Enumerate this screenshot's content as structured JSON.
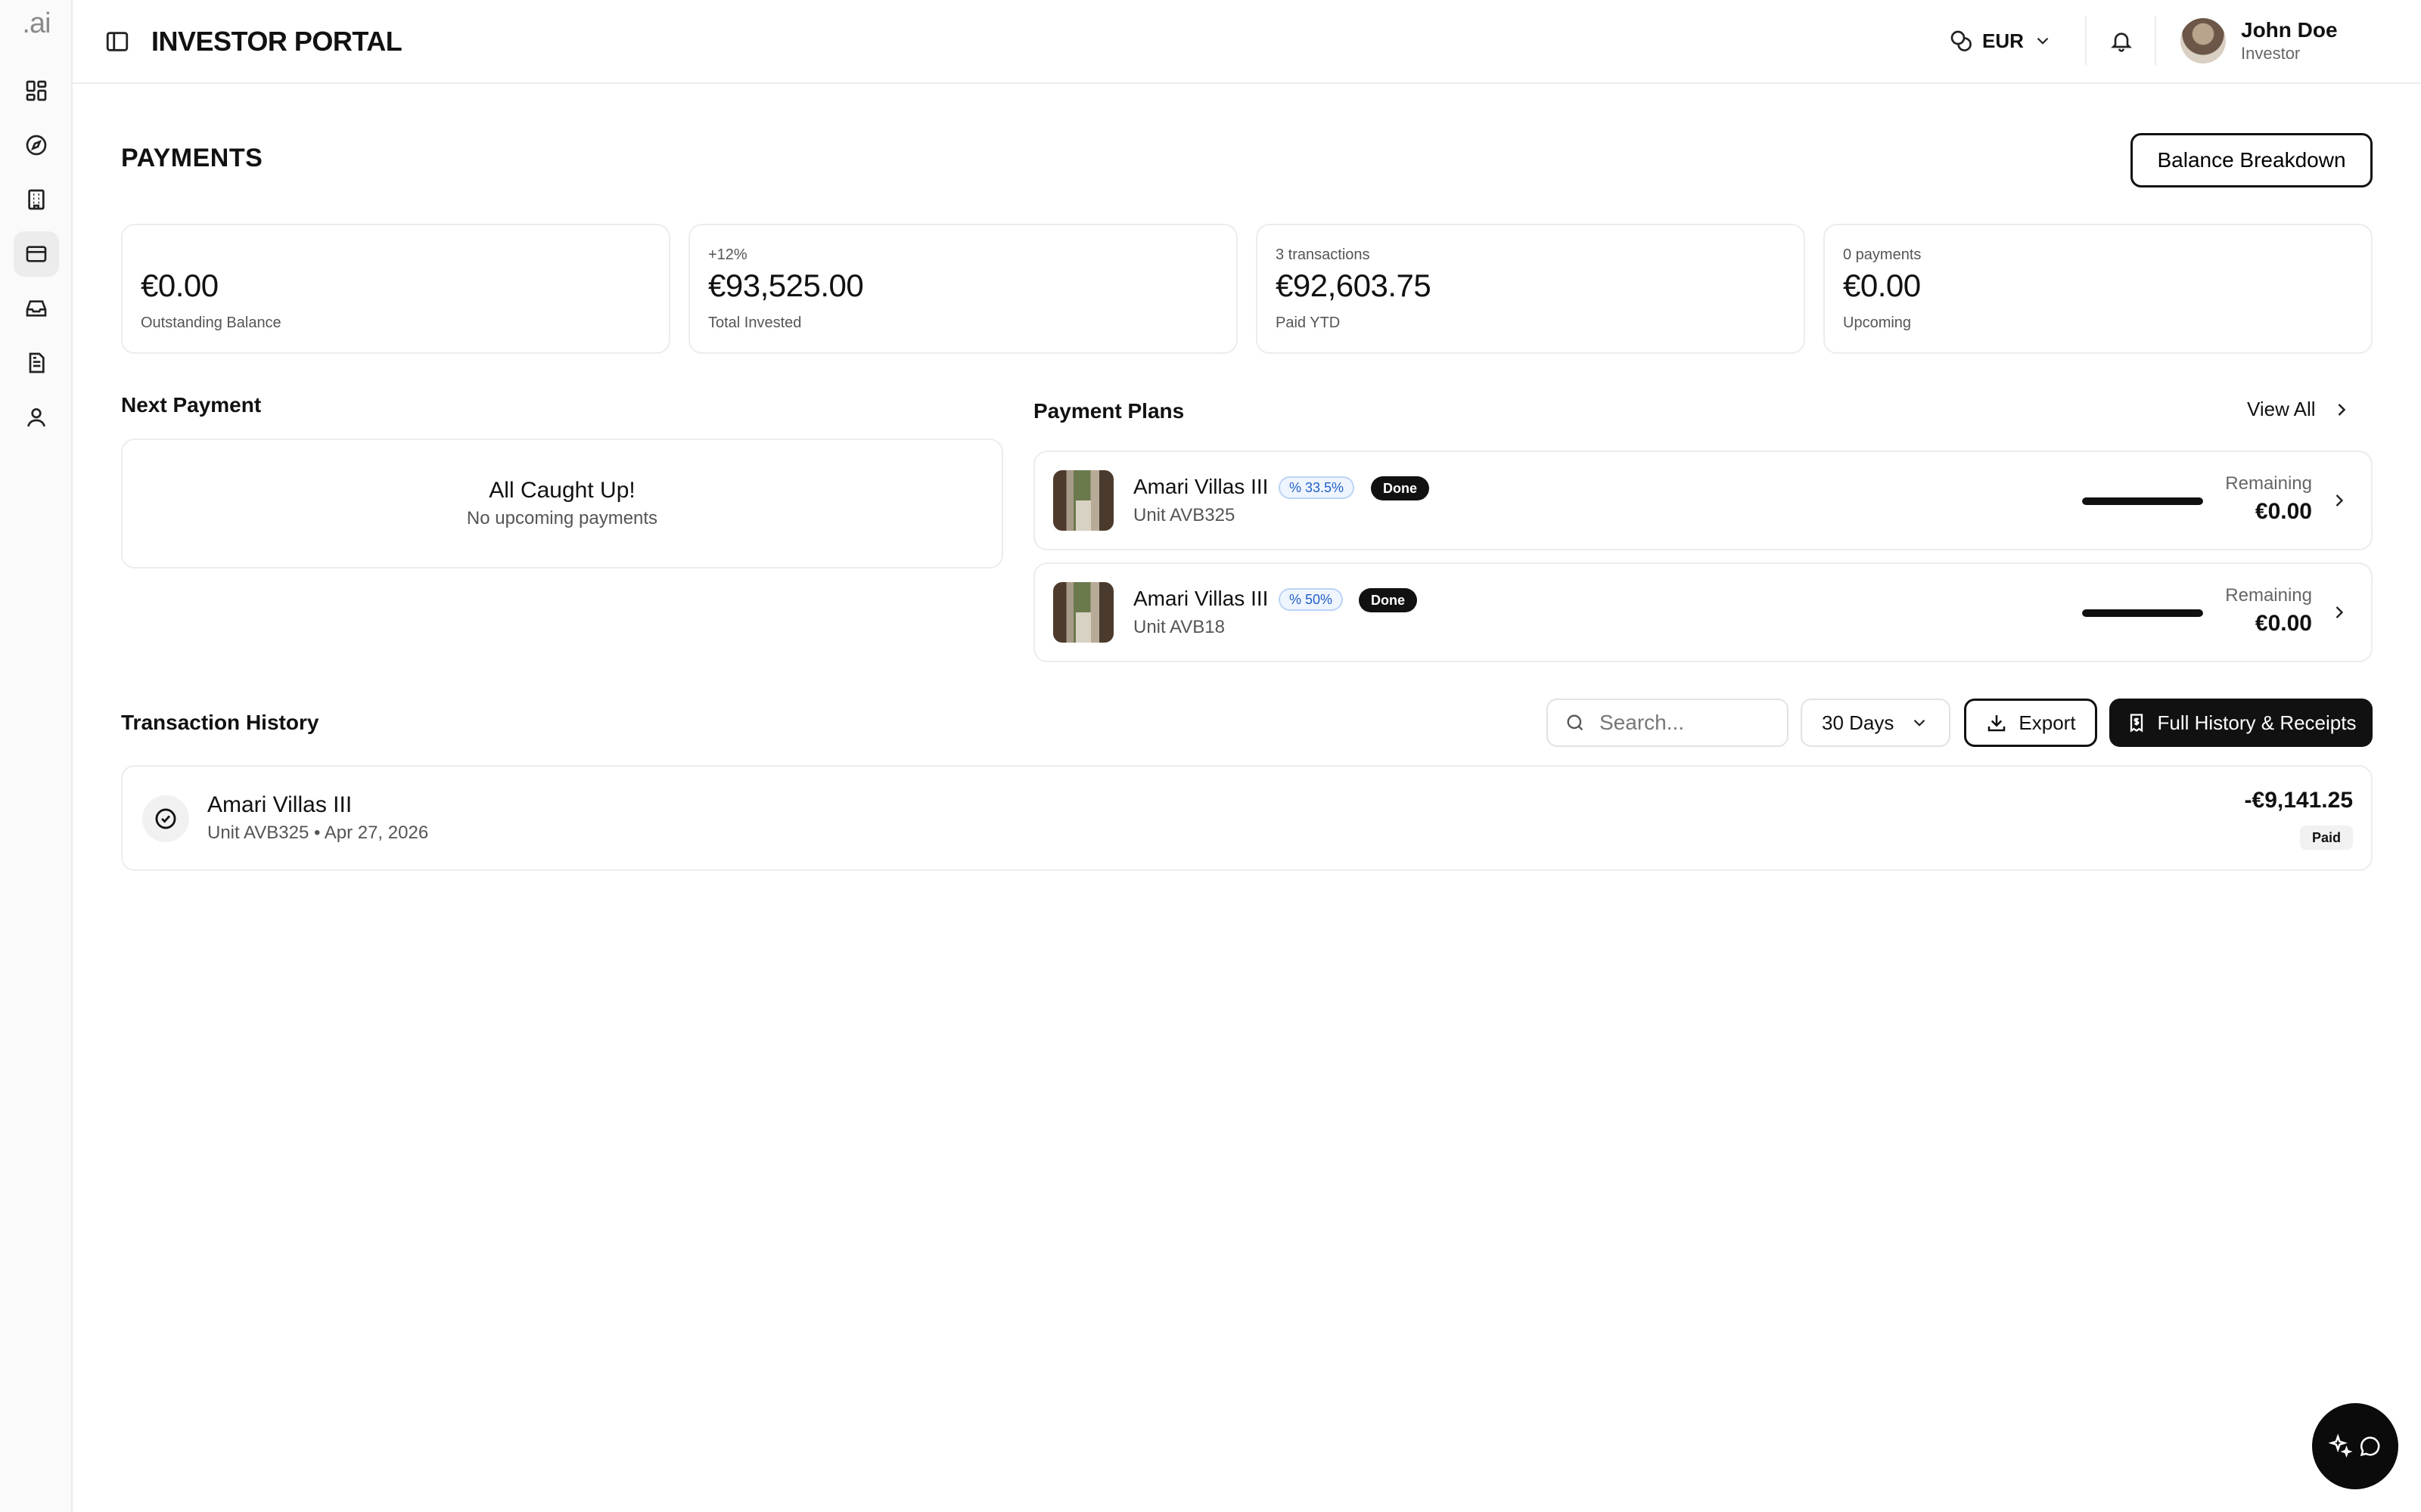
{
  "brand": {
    "logo_text": ".ai"
  },
  "sidebar": {
    "items": [
      {
        "name": "dashboard",
        "icon": "dashboard-icon",
        "active": false
      },
      {
        "name": "explore",
        "icon": "compass-icon",
        "active": false
      },
      {
        "name": "properties",
        "icon": "building-icon",
        "active": false
      },
      {
        "name": "payments",
        "icon": "credit-card-icon",
        "active": true
      },
      {
        "name": "inbox",
        "icon": "inbox-icon",
        "active": false
      },
      {
        "name": "documents",
        "icon": "document-icon",
        "active": false
      },
      {
        "name": "profile",
        "icon": "user-icon",
        "active": false
      }
    ]
  },
  "header": {
    "title": "INVESTOR PORTAL",
    "currency": "EUR",
    "user": {
      "name": "John Doe",
      "role": "Investor"
    }
  },
  "page": {
    "title": "PAYMENTS",
    "balance_breakdown_label": "Balance Breakdown"
  },
  "stats": [
    {
      "top": "",
      "value": "€0.00",
      "label": "Outstanding Balance"
    },
    {
      "top": "+12%",
      "value": "€93,525.00",
      "label": "Total Invested"
    },
    {
      "top": "3 transactions",
      "value": "€92,603.75",
      "label": "Paid YTD"
    },
    {
      "top": "0 payments",
      "value": "€0.00",
      "label": "Upcoming"
    }
  ],
  "next_payment": {
    "title": "Next Payment",
    "empty_title": "All Caught Up!",
    "empty_subtitle": "No upcoming payments"
  },
  "payment_plans": {
    "title": "Payment Plans",
    "view_all_label": "View All",
    "items": [
      {
        "name": "Amari Villas III",
        "percent_label": "33.5%",
        "status": "Done",
        "unit": "Unit AVB325",
        "remaining_label": "Remaining",
        "remaining": "€0.00",
        "progress": 1.0
      },
      {
        "name": "Amari Villas III",
        "percent_label": "50%",
        "status": "Done",
        "unit": "Unit AVB18",
        "remaining_label": "Remaining",
        "remaining": "€0.00",
        "progress": 1.0
      }
    ]
  },
  "transactions": {
    "title": "Transaction History",
    "search_placeholder": "Search...",
    "period": "30 Days",
    "export_label": "Export",
    "full_history_label": "Full History & Receipts",
    "items": [
      {
        "title": "Amari Villas III",
        "subtitle": "Unit AVB325 • Apr 27, 2026",
        "amount": "-€9,141.25",
        "status": "Paid"
      }
    ]
  },
  "colors": {
    "accent": "#111111",
    "badge_blue": "#2361c9",
    "badge_blue_bg": "#eef5ff",
    "border": "#ececec"
  }
}
